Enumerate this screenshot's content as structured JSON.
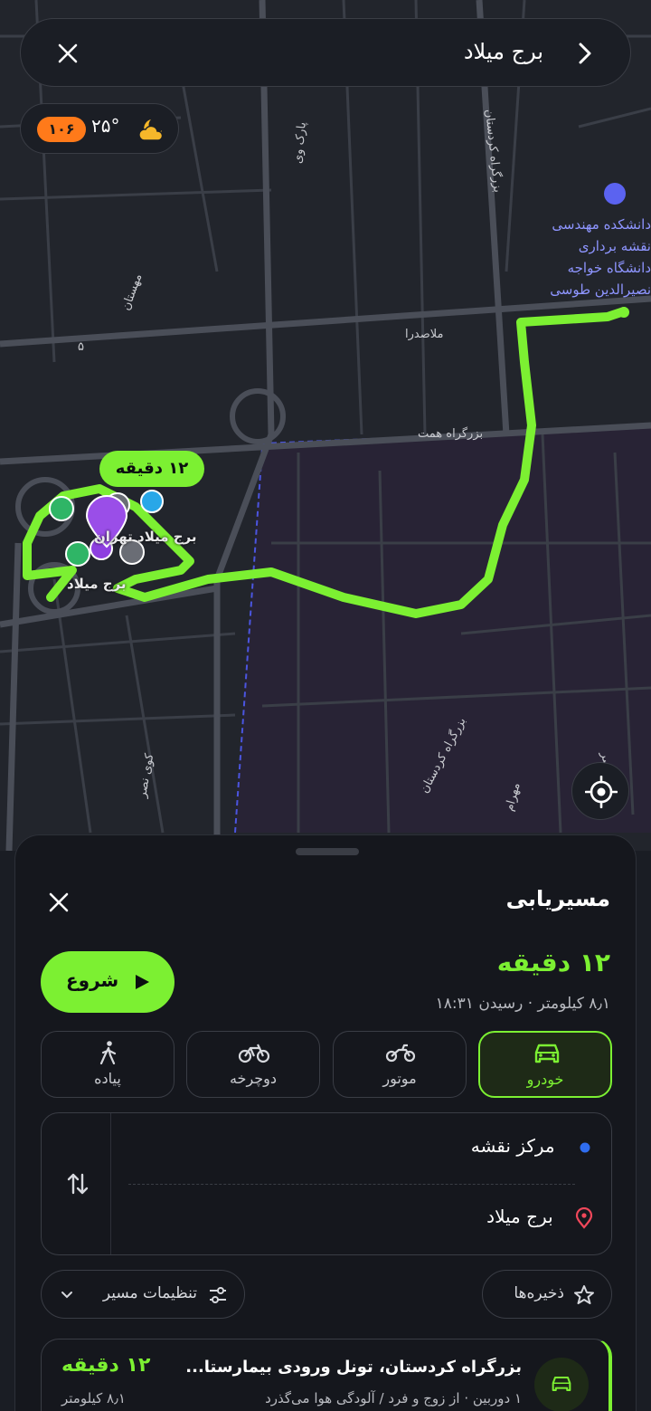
{
  "search": {
    "title": "برج میلاد"
  },
  "weather": {
    "aqi": "۱۰۶",
    "temperature": "۲۵°",
    "icon": "moon-cloud-icon"
  },
  "map": {
    "time_bubble": "۱۲ دقیقه",
    "pin_label_1": "برج میلاد تهران",
    "pin_label_2": "برج میلاد",
    "street_labels": {
      "s1": "بزرگراه کردستان",
      "s2": "ملاصدرا",
      "s3": "بزرگراه همت",
      "s4": "بزرگراه کردستان",
      "s5": "مهستان",
      "s6": "مهرام",
      "s7": "ولی عصر",
      "s8": "کوی نصر",
      "s9": "پارک وی",
      "s10": "۵"
    },
    "poi": "دانشکده مهندسی نقشه برداری دانشگاه خواجه نصیرالدین طوسی"
  },
  "sheet": {
    "title": "مسیریابی",
    "eta": "۱۲ دقیقه",
    "eta_sub": "۸٫۱ کیلومتر · رسیدن ۱۸:۳۱",
    "start_label": "شروع",
    "modes": [
      {
        "label": "خودرو",
        "icon": "car-icon",
        "active": true
      },
      {
        "label": "موتور",
        "icon": "motorcycle-icon",
        "active": false
      },
      {
        "label": "دوچرخه",
        "icon": "bicycle-icon",
        "active": false
      },
      {
        "label": "پیاده",
        "icon": "walk-icon",
        "active": false
      }
    ],
    "origin": "مرکز نقشه",
    "destination": "برج میلاد",
    "saved_label": "ذخیره‌ها",
    "settings_label": "تنظیمات مسیر",
    "result": {
      "title": "بزرگراه کردستان، تونل ورودی بیمارستا...",
      "subtitle": "۱ دوربین · از زوج و فرد / آلودگی هوا می‌گذرد",
      "time": "۱۲ دقیقه",
      "distance": "۸٫۱ کیلومتر"
    }
  },
  "colors": {
    "accent": "#7cf032",
    "aqi": "#ff7a1a",
    "background": "#15171d"
  }
}
